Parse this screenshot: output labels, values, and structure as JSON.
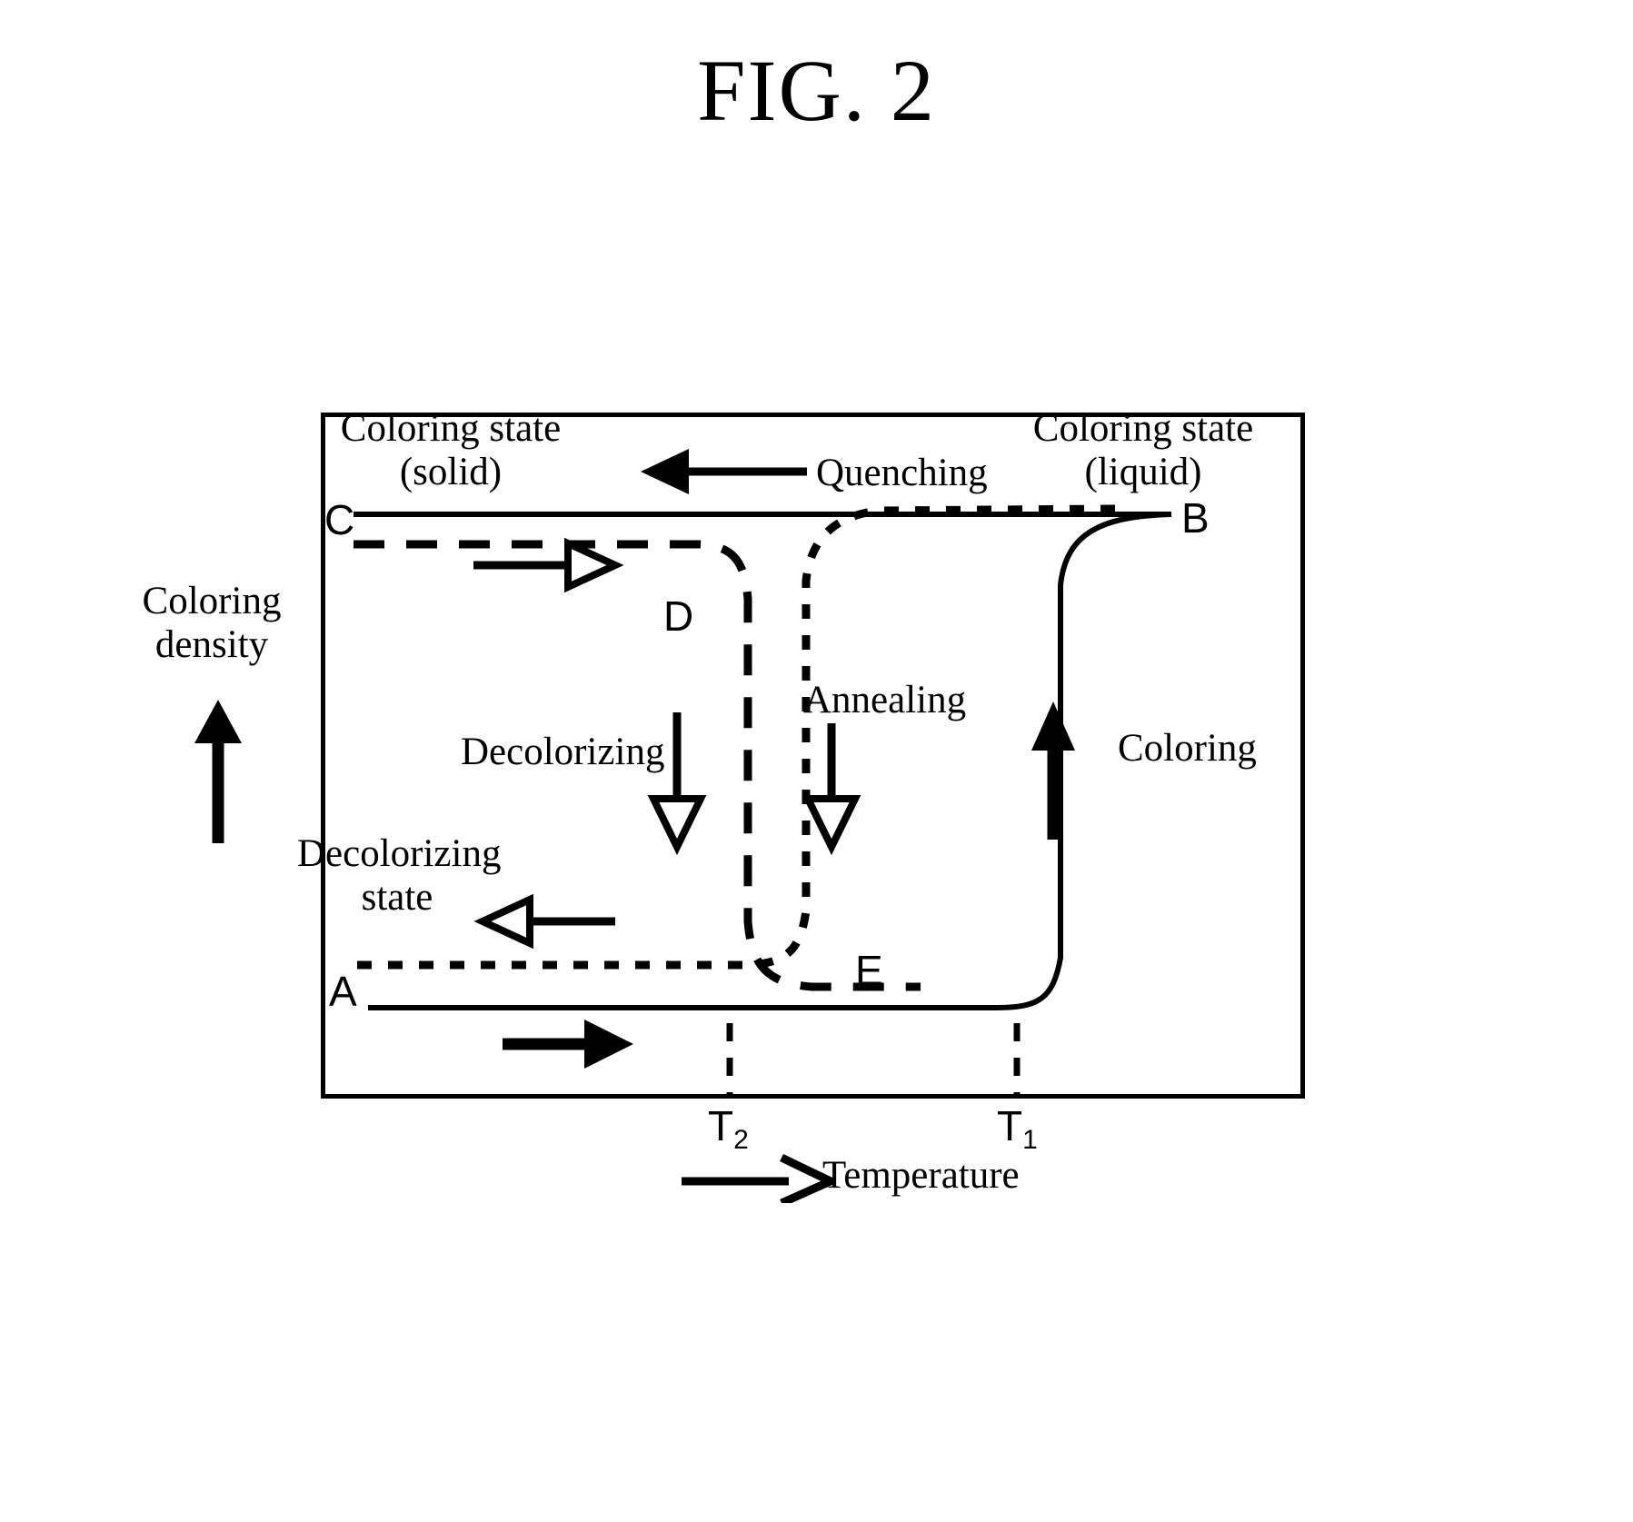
{
  "figure": {
    "title": "FIG. 2"
  },
  "axes": {
    "y_label_line1": "Coloring",
    "y_label_line2": "density",
    "y_arrow_icon": "arrow-up-icon",
    "x_label": "Temperature",
    "x_arrow_icon": "arrow-right-icon",
    "x_ticks": [
      {
        "label": "T",
        "sub": "2"
      },
      {
        "label": "T",
        "sub": "1"
      }
    ]
  },
  "regions": {
    "coloring_state_solid_line1": "Coloring state",
    "coloring_state_solid_line2": "(solid)",
    "coloring_state_liquid_line1": "Coloring state",
    "coloring_state_liquid_line2": "(liquid)",
    "decolorizing_state_line1": "Decolorizing",
    "decolorizing_state_line2": "state"
  },
  "processes": {
    "quenching": "Quenching",
    "annealing": "Annealing",
    "coloring": "Coloring",
    "decolorizing": "Decolorizing"
  },
  "points": {
    "A": "A",
    "B": "B",
    "C": "C",
    "D": "D",
    "E": "E"
  },
  "colors": {
    "ink": "#000000",
    "paper": "#ffffff"
  },
  "chart_data": {
    "type": "line",
    "title": "FIG. 2",
    "xlabel": "Temperature",
    "ylabel": "Coloring density",
    "grid": false,
    "legend": "none",
    "xlim": [
      0,
      1
    ],
    "ylim": [
      0,
      1
    ],
    "x_tick_labels": [
      "T2",
      "T1"
    ],
    "x_tick_positions": [
      0.41,
      0.7
    ],
    "annotations": [
      {
        "text": "Coloring state (solid)",
        "x": 0.06,
        "y": 0.92
      },
      {
        "text": "Coloring state (liquid)",
        "x": 0.78,
        "y": 0.92
      },
      {
        "text": "Quenching",
        "x": 0.54,
        "y": 0.86
      },
      {
        "text": "Annealing",
        "x": 0.52,
        "y": 0.52
      },
      {
        "text": "Coloring",
        "x": 0.84,
        "y": 0.45
      },
      {
        "text": "Decolorizing",
        "x": 0.18,
        "y": 0.45
      },
      {
        "text": "Decolorizing state",
        "x": 0.02,
        "y": 0.26
      },
      {
        "text": "A",
        "x": 0.02,
        "y": 0.08
      },
      {
        "text": "B",
        "x": 0.96,
        "y": 0.86
      },
      {
        "text": "C",
        "x": 0.01,
        "y": 0.86
      },
      {
        "text": "D",
        "x": 0.36,
        "y": 0.7
      },
      {
        "text": "E",
        "x": 0.58,
        "y": 0.12
      }
    ],
    "series": [
      {
        "name": "Coloring (solid line, A -> B -> C)",
        "style": "solid",
        "description": "Low density plateau from A rising steeply at T1 to high density plateau, continuing left to C",
        "x": [
          0.05,
          0.6,
          0.66,
          0.695,
          0.7,
          0.715,
          0.76,
          0.88,
          0.96,
          0.05
        ],
        "y": [
          0.075,
          0.075,
          0.08,
          0.13,
          0.45,
          0.8,
          0.86,
          0.875,
          0.875,
          0.875
        ]
      },
      {
        "name": "Decolorizing (long-dash, C -> D -> E)",
        "style": "dashed",
        "description": "High density plateau from C dropping steeply just before T2 to low density plateau ending at E",
        "x": [
          0.045,
          0.36,
          0.4,
          0.415,
          0.42,
          0.435,
          0.47,
          0.55,
          0.58
        ],
        "y": [
          0.845,
          0.845,
          0.83,
          0.74,
          0.4,
          0.13,
          0.085,
          0.075,
          0.075
        ]
      },
      {
        "name": "Annealing (fine-dotted, E -> A low side)",
        "style": "dotted",
        "description": "Low density plateau rising steeply just after T2 up to the high density plateau near B",
        "x": [
          0.045,
          0.4,
          0.44,
          0.455,
          0.46,
          0.475,
          0.52,
          0.62,
          0.72,
          0.8
        ],
        "y": [
          0.105,
          0.105,
          0.115,
          0.2,
          0.52,
          0.83,
          0.875,
          0.885,
          0.885,
          0.885
        ]
      }
    ],
    "flow_arrows": [
      {
        "name": "quenching-arrow",
        "direction": "left",
        "filled": true,
        "x": 0.42,
        "y": 0.865
      },
      {
        "name": "coloring-top-arrow",
        "direction": "right",
        "filled": false,
        "x": 0.22,
        "y": 0.8
      },
      {
        "name": "decolorizing-down-arrow",
        "direction": "down",
        "filled": false,
        "x": 0.355,
        "y": 0.4
      },
      {
        "name": "annealing-down-arrow",
        "direction": "down",
        "filled": false,
        "x": 0.505,
        "y": 0.4
      },
      {
        "name": "coloring-up-arrow",
        "direction": "up",
        "filled": true,
        "x": 0.745,
        "y": 0.42
      },
      {
        "name": "decolorizing-left-arrow",
        "direction": "left",
        "filled": false,
        "x": 0.2,
        "y": 0.22
      },
      {
        "name": "coloring-bottom-arrow",
        "direction": "right",
        "filled": true,
        "x": 0.22,
        "y": 0.03
      }
    ]
  }
}
